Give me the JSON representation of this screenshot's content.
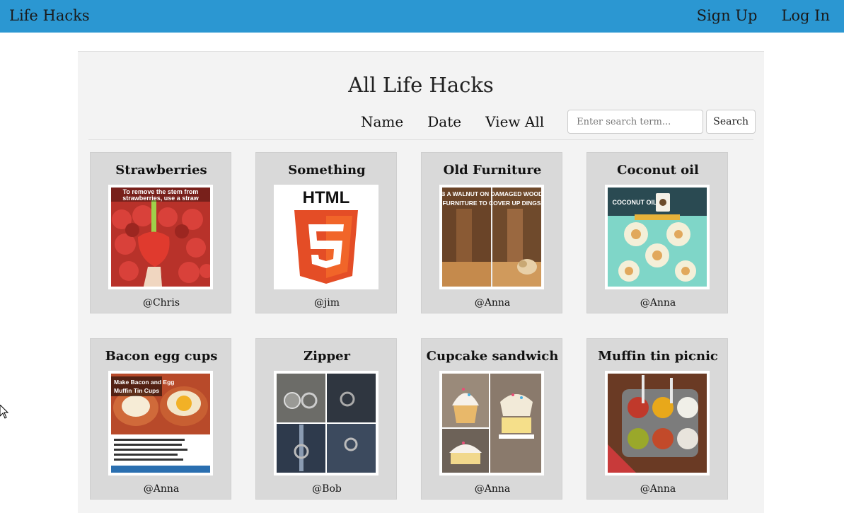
{
  "navbar": {
    "brand": "Life Hacks",
    "links": [
      "Sign Up",
      "Log In"
    ],
    "color": "#2b97d2"
  },
  "main": {
    "title": "All Life Hacks",
    "sort_links": [
      "Name",
      "Date",
      "View All"
    ],
    "search": {
      "placeholder": "Enter search term...",
      "value": "",
      "button_label": "Search"
    }
  },
  "hacks": [
    {
      "title": "Strawberries",
      "author": "@Chris",
      "image_text": "To remove the stem from strawberries, use a straw"
    },
    {
      "title": "Something",
      "author": "@jim",
      "image_text": "HTML"
    },
    {
      "title": "Old Furniture",
      "author": "@Anna",
      "image_text": "RUB A WALNUT ON DAMAGED WOODEN FURNITURE TO COVER UP DINGS"
    },
    {
      "title": "Coconut oil",
      "author": "@Anna",
      "image_text": "COCONUT OIL"
    },
    {
      "title": "Bacon egg cups",
      "author": "@Anna",
      "image_text": "Make Bacon and Egg Muffin Tin Cups"
    },
    {
      "title": "Zipper",
      "author": "@Bob",
      "image_text": ""
    },
    {
      "title": "Cupcake sandwich",
      "author": "@Anna",
      "image_text": ""
    },
    {
      "title": "Muffin tin picnic",
      "author": "@Anna",
      "image_text": ""
    }
  ]
}
